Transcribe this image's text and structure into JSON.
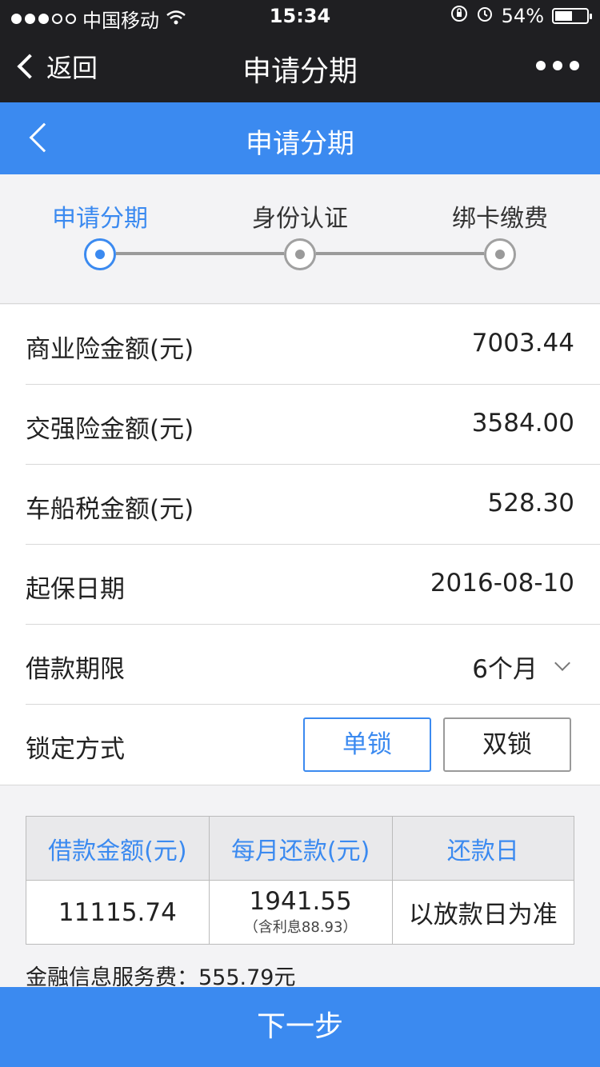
{
  "status_bar": {
    "carrier": "中国移动",
    "time": "15:34",
    "battery": "54%",
    "battery_level": 0.54
  },
  "wx_nav": {
    "back_label": "返回",
    "title": "申请分期"
  },
  "header": {
    "title": "申请分期"
  },
  "steps": [
    {
      "label": "申请分期",
      "active": true
    },
    {
      "label": "身份认证",
      "active": false
    },
    {
      "label": "绑卡缴费",
      "active": false
    }
  ],
  "form": {
    "commercial_insurance": {
      "label": "商业险金额(元)",
      "value": "7003.44"
    },
    "compulsory_insurance": {
      "label": "交强险金额(元)",
      "value": "3584.00"
    },
    "vehicle_tax": {
      "label": "车船税金额(元)",
      "value": "528.30"
    },
    "start_date": {
      "label": "起保日期",
      "value": "2016-08-10"
    },
    "loan_term": {
      "label": "借款期限",
      "value": "6个月"
    },
    "lock_mode": {
      "label": "锁定方式",
      "options": [
        "单锁",
        "双锁"
      ],
      "selected": "单锁"
    }
  },
  "summary_table": {
    "headers": [
      "借款金额(元)",
      "每月还款(元)",
      "还款日"
    ],
    "loan_amount": "11115.74",
    "monthly_payment": "1941.55",
    "monthly_interest_note": "（含利息88.93）",
    "repayment_day": "以放款日为准"
  },
  "fee_text": "金融信息服务费：555.79元",
  "next_button": "下一步",
  "colors": {
    "primary": "#3b8af0",
    "nav_dark": "#1f1f22"
  }
}
